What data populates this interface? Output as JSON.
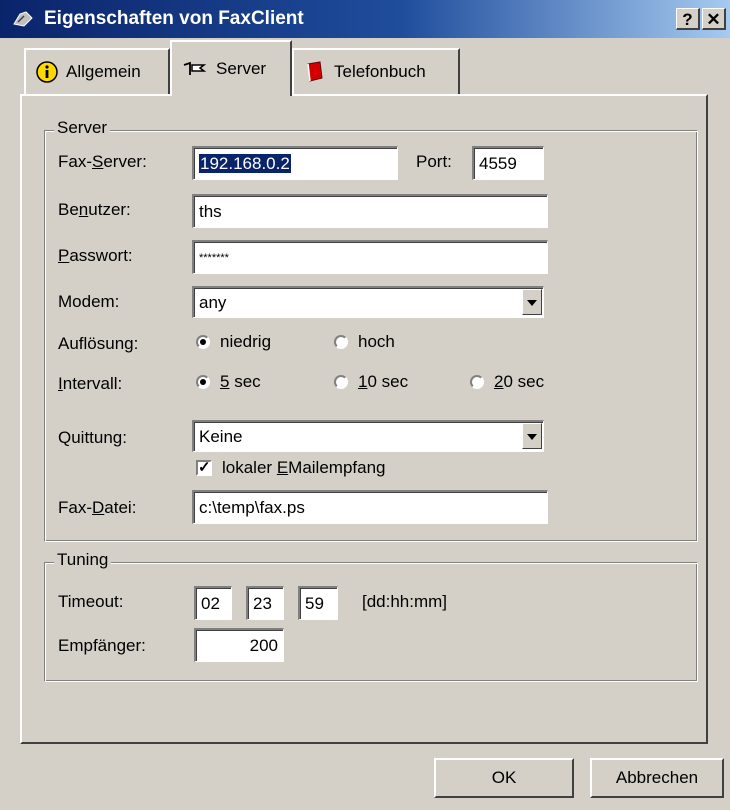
{
  "window": {
    "title": "Eigenschaften von FaxClient",
    "help_label": "?",
    "close_label": "✕"
  },
  "tabs": [
    {
      "label": "Allgemein",
      "icon": "info-icon"
    },
    {
      "label": "Server",
      "icon": "server-icon",
      "active": true
    },
    {
      "label": "Telefonbuch",
      "icon": "phonebook-icon"
    }
  ],
  "server_group": {
    "legend": "Server",
    "fax_server": {
      "label_pre": "Fax-",
      "label_u": "S",
      "label_post": "erver:",
      "value": "192.168.0.2"
    },
    "port": {
      "label": "Port:",
      "value": "4559"
    },
    "benutzer": {
      "label_pre": "Be",
      "label_u": "n",
      "label_post": "utzer:",
      "value": "ths"
    },
    "passwort": {
      "label_pre": "",
      "label_u": "P",
      "label_post": "asswort:",
      "value": "*******"
    },
    "modem": {
      "label": "Modem:",
      "value": "any"
    },
    "aufloesung": {
      "label": "Auflösung:",
      "options": [
        {
          "label": "niedrig",
          "checked": true
        },
        {
          "label": "hoch",
          "checked": false
        }
      ]
    },
    "intervall": {
      "label_pre": "",
      "label_u": "I",
      "label_post": "ntervall:",
      "options": [
        {
          "u": "5",
          "rest": " sec",
          "checked": true
        },
        {
          "u": "1",
          "rest": "0 sec",
          "checked": false
        },
        {
          "u": "2",
          "rest": "0 sec",
          "checked": false
        }
      ]
    },
    "quittung": {
      "label": "Quittung:",
      "value": "Keine"
    },
    "lokaler_email": {
      "label_pre": "lokaler ",
      "label_u": "E",
      "label_post": "Mailempfang",
      "checked": true
    },
    "fax_datei": {
      "label_pre": "Fax-",
      "label_u": "D",
      "label_post": "atei:",
      "value": "c:\\temp\\fax.ps"
    }
  },
  "tuning_group": {
    "legend": "Tuning",
    "timeout": {
      "label": "Timeout:",
      "dd": "02",
      "hh": "23",
      "mm": "59",
      "format": "[dd:hh:mm]"
    },
    "empfaenger": {
      "label": "Empfänger:",
      "value": "200"
    }
  },
  "buttons": {
    "ok": "OK",
    "cancel": "Abbrechen"
  },
  "colors": {
    "face": "#d4d0c8",
    "titlebar": "#0a246a",
    "selection": "#0a246a"
  }
}
